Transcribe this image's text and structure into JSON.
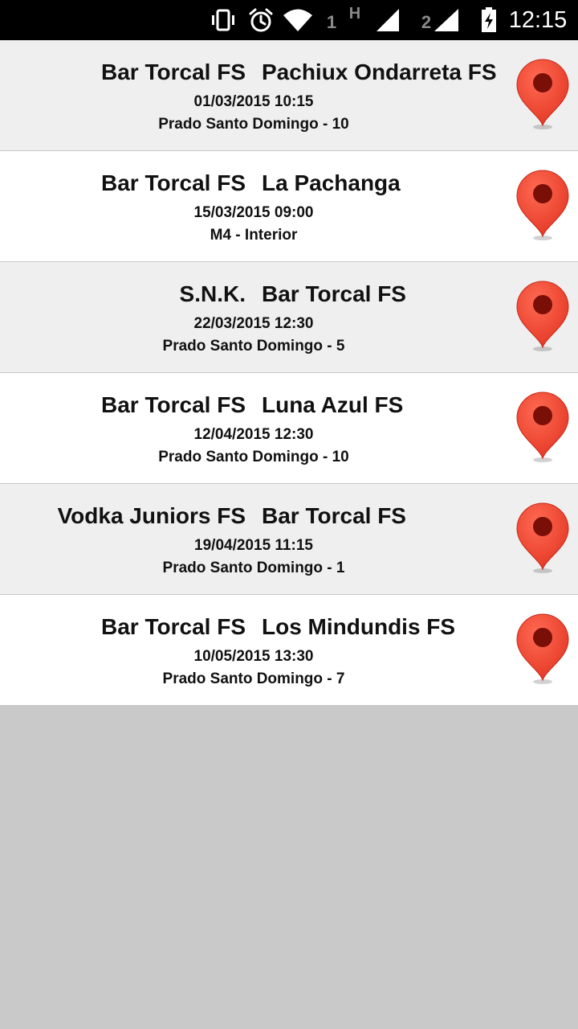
{
  "status_bar": {
    "icons": [
      "vibrate-icon",
      "alarm-icon",
      "wifi-icon",
      "signal-icon",
      "signal-icon",
      "battery-charging-icon"
    ],
    "sim1_label": "1",
    "network_type": "H",
    "sim2_label": "2",
    "time": "12:15"
  },
  "colors": {
    "pin_red": "#e53a27",
    "pin_dark": "#7a0f08",
    "row_alt": "#efefef",
    "row_plain": "#ffffff",
    "empty_area": "#c9c9c9"
  },
  "matches": [
    {
      "home": "Bar Torcal FS",
      "away": "Pachiux Ondarreta FS",
      "datetime": "01/03/2015 10:15",
      "venue": "Prado Santo Domingo - 10",
      "icon": "map-pin-icon"
    },
    {
      "home": "Bar Torcal FS",
      "away": "La Pachanga",
      "datetime": "15/03/2015 09:00",
      "venue": "M4 - Interior",
      "icon": "map-pin-icon"
    },
    {
      "home": "S.N.K.",
      "away": "Bar Torcal FS",
      "datetime": "22/03/2015 12:30",
      "venue": "Prado Santo Domingo - 5",
      "icon": "map-pin-icon"
    },
    {
      "home": "Bar Torcal FS",
      "away": "Luna Azul FS",
      "datetime": "12/04/2015 12:30",
      "venue": "Prado Santo Domingo - 10",
      "icon": "map-pin-icon"
    },
    {
      "home": "Vodka Juniors FS",
      "away": "Bar Torcal FS",
      "datetime": "19/04/2015 11:15",
      "venue": "Prado Santo Domingo - 1",
      "icon": "map-pin-icon"
    },
    {
      "home": "Bar Torcal FS",
      "away": "Los Mindundis FS",
      "datetime": "10/05/2015 13:30",
      "venue": "Prado Santo Domingo - 7",
      "icon": "map-pin-icon"
    }
  ]
}
